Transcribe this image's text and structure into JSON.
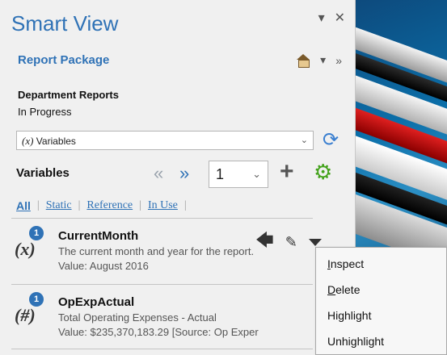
{
  "pane": {
    "title": "Smart View",
    "title_buttons": {
      "dropdown": "▾",
      "close": "✕"
    }
  },
  "report_package": {
    "label": "Report Package",
    "overflow": "»"
  },
  "department": {
    "title": "Department Reports",
    "status": "In Progress"
  },
  "variables_dropdown": {
    "symbol": "(x)",
    "selected": "Variables"
  },
  "variables_toolbar": {
    "heading": "Variables",
    "page": "1"
  },
  "filters": [
    "All",
    "Static",
    "Reference",
    "In Use"
  ],
  "variables": [
    {
      "symbol": "(x)",
      "badge": "1",
      "name": "CurrentMonth",
      "description": "The current month and year for the report.",
      "value": "Value: August 2016"
    },
    {
      "symbol": "(#)",
      "badge": "1",
      "name": "OpExpActual",
      "description": "Total Operating Expenses - Actual",
      "value": "Value: $235,370,183.29 [Source: Op Exper"
    }
  ],
  "context_menu": {
    "items": [
      {
        "key": "I",
        "rest": "nspect"
      },
      {
        "key": "D",
        "rest": "elete"
      },
      {
        "key": "",
        "rest": "Highlight"
      },
      {
        "key": "",
        "rest": "Unhighlight"
      }
    ]
  },
  "colors": {
    "accent": "#2f72b6",
    "gear": "#43a21b",
    "badge": "#2f72b6"
  }
}
